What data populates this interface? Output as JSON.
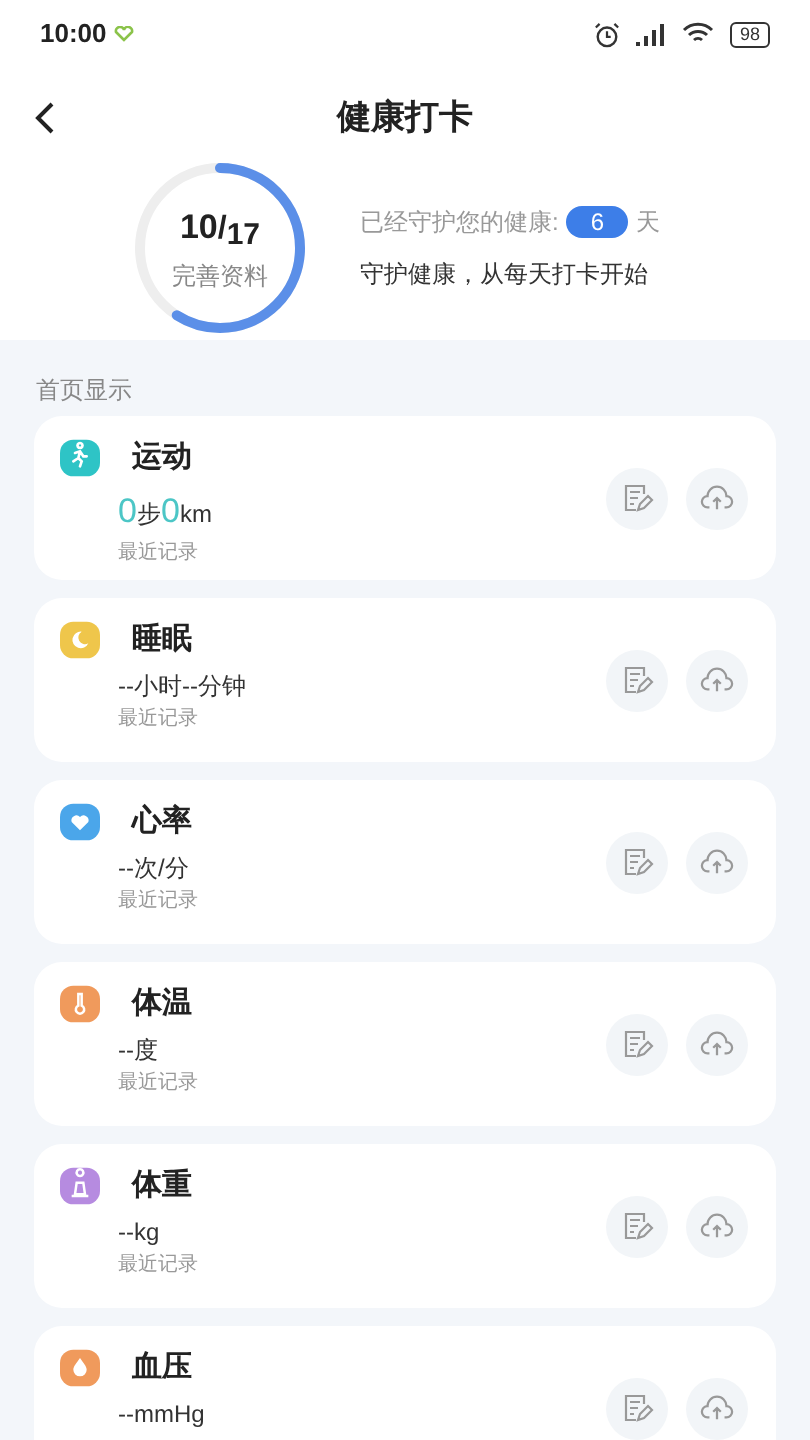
{
  "status_bar": {
    "time": "10:00",
    "battery": "98"
  },
  "header": {
    "title": "健康打卡"
  },
  "progress": {
    "count": "10",
    "slash": "/",
    "total": "17",
    "label": "完善资料",
    "level": 0.59
  },
  "streak": {
    "prefix": "已经守护您的健康:",
    "days": "6",
    "suffix": "天",
    "slogan": "守护健康，从每天打卡开始"
  },
  "section_title": "首页显示",
  "cards": [
    {
      "kind": "sport",
      "title": "运动",
      "color": "#2ec4c6",
      "value_parts": [
        {
          "kind": "number",
          "text": "0"
        },
        {
          "kind": "unit",
          "text": "步"
        },
        {
          "kind": "number",
          "text": "0"
        },
        {
          "kind": "unit",
          "text": "km"
        }
      ],
      "note": "最近记录"
    },
    {
      "kind": "sleep",
      "title": "睡眠",
      "color": "#efc64b",
      "value_parts": [
        {
          "kind": "plain",
          "text": "--小时--分钟"
        }
      ],
      "note": "最近记录"
    },
    {
      "kind": "heart",
      "title": "心率",
      "color": "#4ba6ea",
      "value_parts": [
        {
          "kind": "plain",
          "text": "--次/分"
        }
      ],
      "note": "最近记录"
    },
    {
      "kind": "temperature",
      "title": "体温",
      "color": "#f09a5c",
      "value_parts": [
        {
          "kind": "plain",
          "text": "--度"
        }
      ],
      "note": "最近记录"
    },
    {
      "kind": "weight",
      "title": "体重",
      "color": "#b68be0",
      "value_parts": [
        {
          "kind": "plain",
          "text": "--kg"
        }
      ],
      "note": "最近记录"
    },
    {
      "kind": "pressure",
      "title": "血压",
      "color": "#f09a5c",
      "value_parts": [
        {
          "kind": "plain",
          "text": "--mmHg"
        }
      ]
    }
  ]
}
